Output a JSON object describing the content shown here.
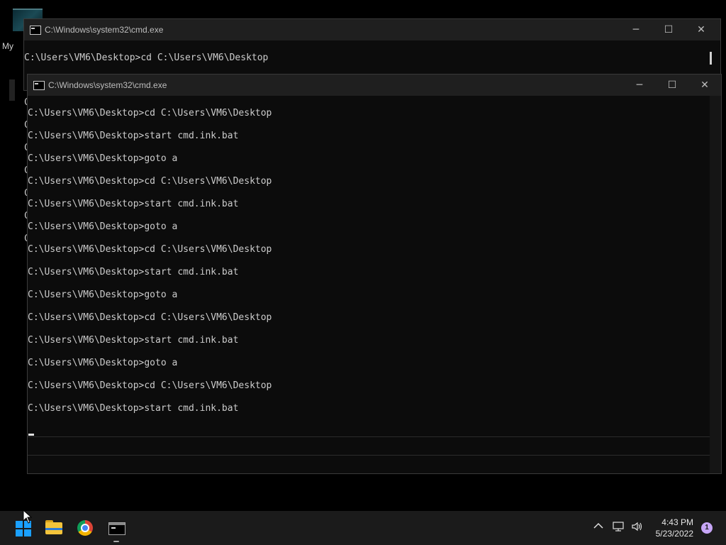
{
  "desktop": {
    "icon_label": "My"
  },
  "window_back": {
    "title": "C:\\Windows\\system32\\cmd.exe",
    "lines": [
      "C:\\Users\\VM6\\Desktop>cd C:\\Users\\VM6\\Desktop"
    ],
    "left_edge_chars": [
      "C",
      "C",
      "C",
      "C",
      "C",
      "C",
      "C"
    ]
  },
  "window_front": {
    "title": "C:\\Windows\\system32\\cmd.exe",
    "lines": [
      "C:\\Users\\VM6\\Desktop>cd C:\\Users\\VM6\\Desktop",
      "C:\\Users\\VM6\\Desktop>start cmd.ink.bat",
      "C:\\Users\\VM6\\Desktop>goto a",
      "C:\\Users\\VM6\\Desktop>cd C:\\Users\\VM6\\Desktop",
      "C:\\Users\\VM6\\Desktop>start cmd.ink.bat",
      "C:\\Users\\VM6\\Desktop>goto a",
      "C:\\Users\\VM6\\Desktop>cd C:\\Users\\VM6\\Desktop",
      "C:\\Users\\VM6\\Desktop>start cmd.ink.bat",
      "C:\\Users\\VM6\\Desktop>goto a",
      "C:\\Users\\VM6\\Desktop>cd C:\\Users\\VM6\\Desktop",
      "C:\\Users\\VM6\\Desktop>start cmd.ink.bat",
      "C:\\Users\\VM6\\Desktop>goto a",
      "C:\\Users\\VM6\\Desktop>cd C:\\Users\\VM6\\Desktop",
      "C:\\Users\\VM6\\Desktop>start cmd.ink.bat"
    ]
  },
  "window_buttons": {
    "minimize": "─",
    "maximize": "☐",
    "close": "✕"
  },
  "taskbar": {
    "items": [
      "start-icon",
      "file-explorer-icon",
      "chrome-icon",
      "command-prompt-icon"
    ],
    "tray": {
      "chevron": "^",
      "network": "network-icon",
      "volume": "volume-icon"
    },
    "clock": {
      "time": "4:43 PM",
      "date": "5/23/2022"
    },
    "notification_count": "1"
  },
  "colors": {
    "console_bg": "#0c0c0c",
    "console_text": "#cccccc",
    "titlebar": "#1f1f1f",
    "taskbar": "#1b1b1b",
    "accent": "#1aa0ff"
  }
}
